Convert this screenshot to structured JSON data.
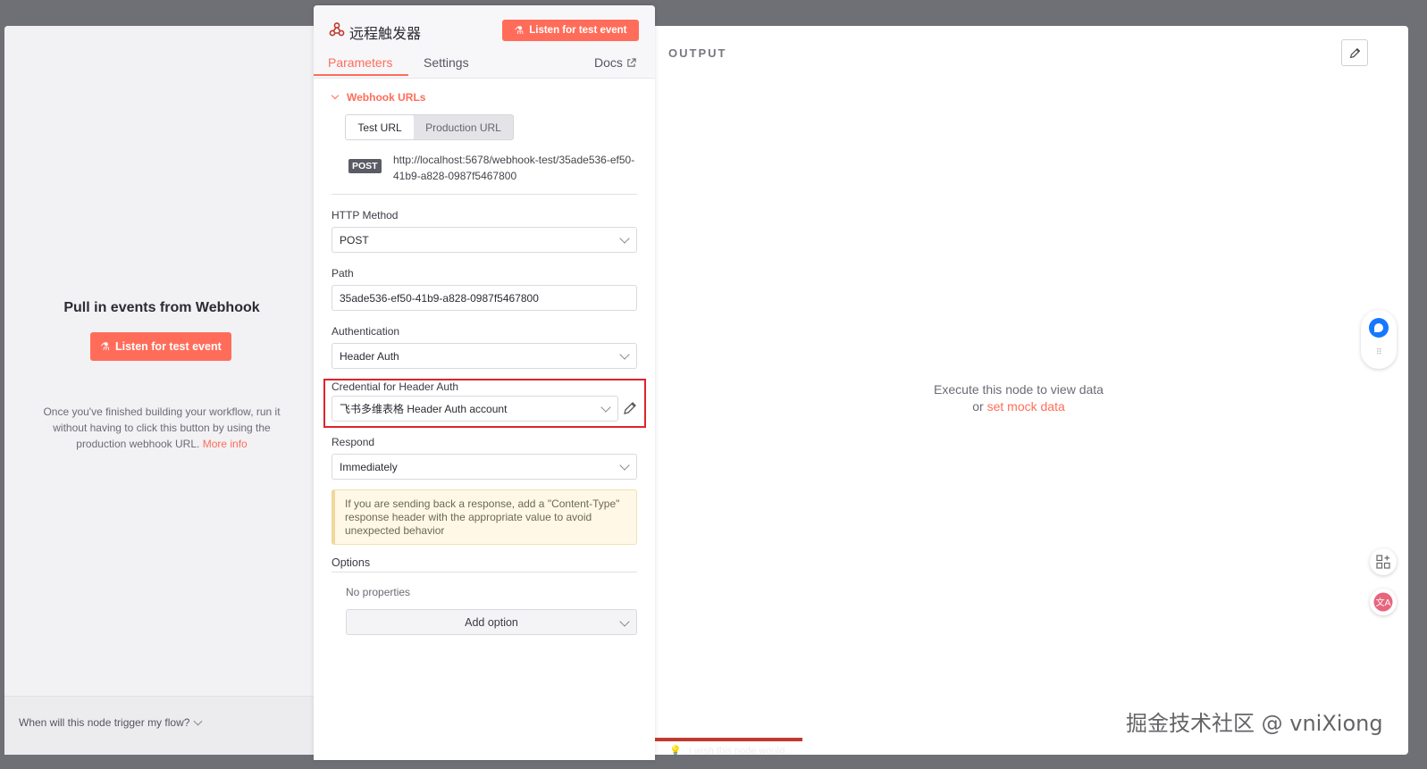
{
  "node": {
    "title": "远程触发器",
    "listen_button": "Listen for test event",
    "tabs": {
      "parameters": "Parameters",
      "settings": "Settings",
      "docs": "Docs"
    }
  },
  "webhook_urls": {
    "section_label": "Webhook URLs",
    "tabs": {
      "test": "Test URL",
      "production": "Production URL"
    },
    "method_badge": "POST",
    "url": "http://localhost:5678/webhook-test/35ade536-ef50-41b9-a828-0987f5467800"
  },
  "fields": {
    "http_method": {
      "label": "HTTP Method",
      "value": "POST"
    },
    "path": {
      "label": "Path",
      "value": "35ade536-ef50-41b9-a828-0987f5467800"
    },
    "authentication": {
      "label": "Authentication",
      "value": "Header Auth"
    },
    "credential": {
      "label": "Credential for Header Auth",
      "value": "飞书多维表格 Header Auth account"
    },
    "respond": {
      "label": "Respond",
      "value": "Immediately"
    }
  },
  "notice": "If you are sending back a response, add a \"Content-Type\" response header with the appropriate value to avoid unexpected behavior",
  "options": {
    "label": "Options",
    "empty_text": "No properties",
    "add_button": "Add option"
  },
  "input_pane": {
    "title": "Pull in events from Webhook",
    "listen_button": "Listen for test event",
    "note": "Once you've finished building your workflow, run it without having to click this button by using the production webhook URL.",
    "more_info": "More info",
    "trigger_question": "When will this node trigger my flow?"
  },
  "output_pane": {
    "label": "OUTPUT",
    "empty_line1": "Execute this node to view data",
    "empty_or": "or",
    "mock_link": "set mock data"
  },
  "bottom_hint": "I wish this node would...",
  "watermark": "掘金技术社区 @ vniXiong",
  "colors": {
    "accent": "#ff6d5a",
    "highlight_border": "#e0232c",
    "notice_bg": "#fff8e6"
  }
}
